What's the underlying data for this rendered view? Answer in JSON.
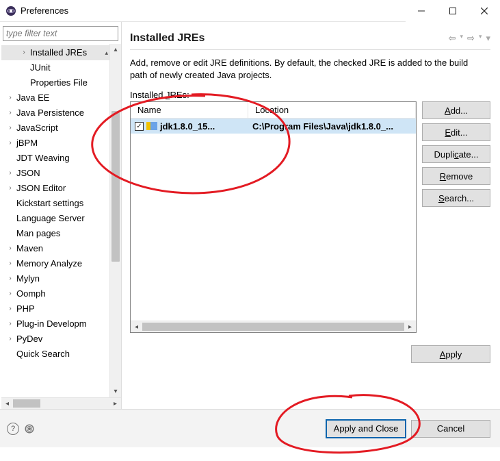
{
  "window": {
    "title": "Preferences"
  },
  "sidebar": {
    "filter_placeholder": "type filter text",
    "items": [
      {
        "label": "Installed JREs",
        "level": 2,
        "expandable": true,
        "selected": true
      },
      {
        "label": "JUnit",
        "level": 2,
        "expandable": false
      },
      {
        "label": "Properties File",
        "level": 2,
        "expandable": false
      },
      {
        "label": "Java EE",
        "level": 1,
        "expandable": true
      },
      {
        "label": "Java Persistence",
        "level": 1,
        "expandable": true
      },
      {
        "label": "JavaScript",
        "level": 1,
        "expandable": true
      },
      {
        "label": "jBPM",
        "level": 1,
        "expandable": true
      },
      {
        "label": "JDT Weaving",
        "level": 1,
        "expandable": false
      },
      {
        "label": "JSON",
        "level": 1,
        "expandable": true
      },
      {
        "label": "JSON Editor",
        "level": 1,
        "expandable": true
      },
      {
        "label": "Kickstart settings",
        "level": 1,
        "expandable": false
      },
      {
        "label": "Language Server",
        "level": 1,
        "expandable": false
      },
      {
        "label": "Man pages",
        "level": 1,
        "expandable": false
      },
      {
        "label": "Maven",
        "level": 1,
        "expandable": true
      },
      {
        "label": "Memory Analyze",
        "level": 1,
        "expandable": true
      },
      {
        "label": "Mylyn",
        "level": 1,
        "expandable": true
      },
      {
        "label": "Oomph",
        "level": 1,
        "expandable": true
      },
      {
        "label": "PHP",
        "level": 1,
        "expandable": true
      },
      {
        "label": "Plug-in Developm",
        "level": 1,
        "expandable": true
      },
      {
        "label": "PyDev",
        "level": 1,
        "expandable": true
      },
      {
        "label": "Quick Search",
        "level": 1,
        "expandable": false
      }
    ]
  },
  "main": {
    "title": "Installed JREs",
    "description": "Add, remove or edit JRE definitions. By default, the checked JRE is added to the build path of newly created Java projects.",
    "section_label_pre": "Installed ",
    "section_label_mn": "J",
    "section_label_post": "REs:",
    "columns": {
      "name": "Name",
      "location": "Location"
    },
    "rows": [
      {
        "checked": true,
        "name": "jdk1.8.0_15...",
        "location": "C:\\Program Files\\Java\\jdk1.8.0_..."
      }
    ],
    "buttons": {
      "add": "Add...",
      "edit": "Edit...",
      "duplicate": "Duplicate...",
      "remove": "Remove",
      "search": "Search..."
    },
    "apply": "Apply"
  },
  "bottom": {
    "apply_close": "Apply and Close",
    "cancel": "Cancel"
  }
}
